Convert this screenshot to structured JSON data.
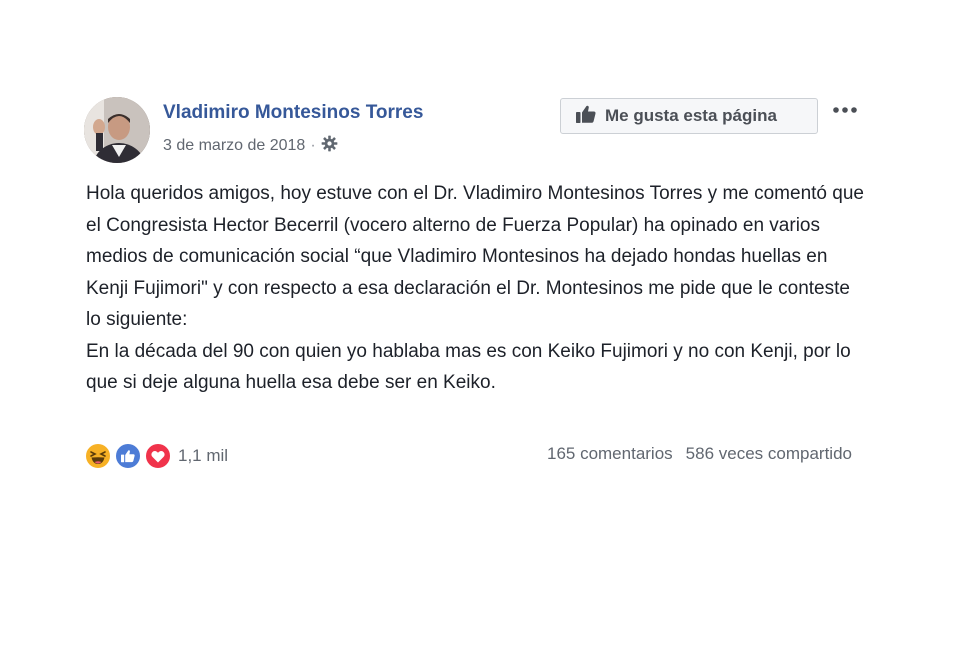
{
  "post": {
    "author": "Vladimiro Montesinos Torres",
    "date": "3 de marzo de 2018",
    "separator": "·",
    "audience_icon": "gear-icon",
    "like_page_button": "Me gusta esta página",
    "more_options_icon": "ellipsis-icon",
    "paragraphs": [
      "Hola queridos amigos, hoy estuve con el Dr. Vladimiro Montesinos Torres y me comentó que el Congresista Hector Becerril (vocero alterno de Fuerza Popular) ha opinado en varios medios de comunicación social “que Vladimiro Montesinos ha dejado hondas huellas en Kenji Fujimori\" y con respecto a esa declaración el Dr. Montesinos me pide que le conteste lo siguiente:",
      "En la década del 90 con quien yo hablaba mas es con Keiko Fujimori y no con Kenji, por lo que si deje alguna huella esa debe ser en Keiko."
    ]
  },
  "engagement": {
    "reaction_icons": [
      "haha-reaction-icon",
      "like-reaction-icon",
      "love-reaction-icon"
    ],
    "reaction_count": "1,1 mil",
    "comments": "165 comentarios",
    "shares": "586 veces compartido"
  },
  "colors": {
    "author": "#365899",
    "text": "#1d2129",
    "muted": "#616770",
    "haha": "#f7b125",
    "like": "#4d7cd6",
    "love": "#f0334b"
  }
}
